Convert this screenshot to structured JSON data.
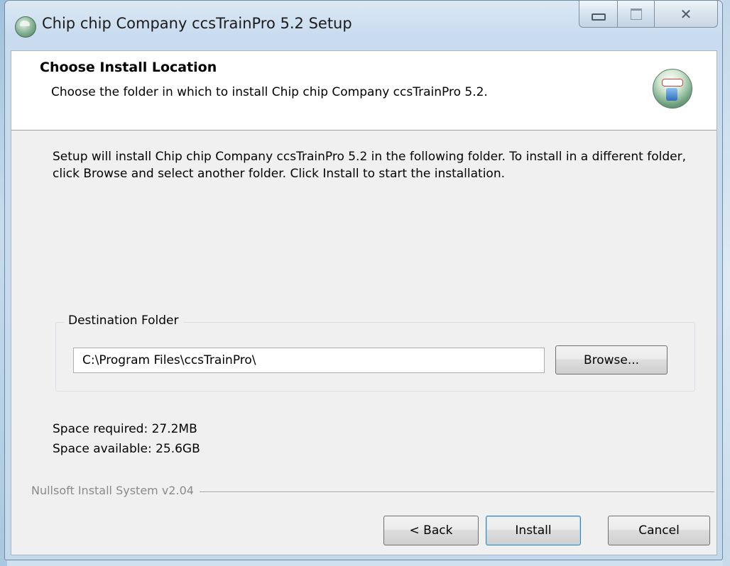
{
  "window": {
    "title": "Chip chip Company ccsTrainPro 5.2 Setup",
    "icons": {
      "app": "setup-globe-icon",
      "minimize": "minimize-icon",
      "maximize": "maximize-icon",
      "close": "close-icon"
    },
    "close_glyph": "✕"
  },
  "header": {
    "title": "Choose Install Location",
    "subtitle": "Choose the folder in which to install Chip chip Company ccsTrainPro 5.2.",
    "icon": "installer-globe-icon"
  },
  "intro_text": "Setup will install Chip chip Company ccsTrainPro 5.2 in the following folder. To install in a different folder, click Browse and select another folder. Click Install to start the installation.",
  "destination": {
    "group_label": "Destination Folder",
    "path": "C:\\Program Files\\ccsTrainPro\\",
    "browse_label": "Browse..."
  },
  "space": {
    "required": "Space required: 27.2MB",
    "available": "Space available: 25.6GB"
  },
  "footer": {
    "branding": "Nullsoft Install System v2.04",
    "back_label": "< Back",
    "install_label": "Install",
    "cancel_label": "Cancel"
  }
}
